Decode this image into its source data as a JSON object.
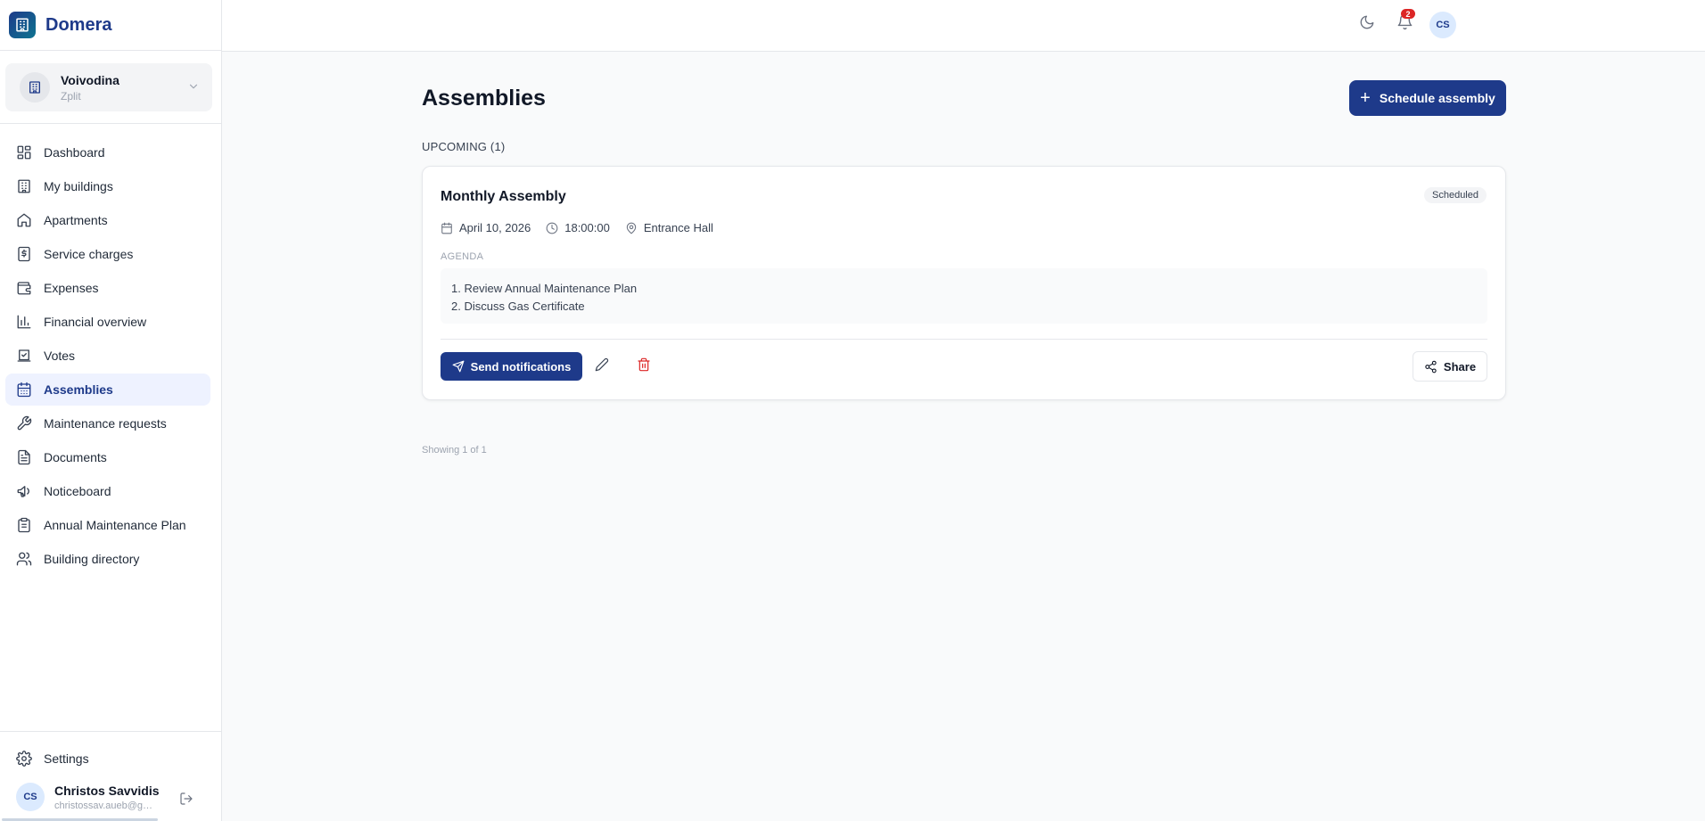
{
  "app": {
    "name": "Domera"
  },
  "building": {
    "name": "Voivodina",
    "subtitle": "Zplit"
  },
  "nav": {
    "items": [
      {
        "label": "Dashboard",
        "icon": "grid-icon"
      },
      {
        "label": "My buildings",
        "icon": "building-icon"
      },
      {
        "label": "Apartments",
        "icon": "home-icon"
      },
      {
        "label": "Service charges",
        "icon": "dollar-receipt-icon"
      },
      {
        "label": "Expenses",
        "icon": "wallet-icon"
      },
      {
        "label": "Financial overview",
        "icon": "bar-chart-icon"
      },
      {
        "label": "Votes",
        "icon": "ballot-check-icon"
      },
      {
        "label": "Assemblies",
        "icon": "calendar-icon",
        "active": true
      },
      {
        "label": "Maintenance requests",
        "icon": "wrench-icon"
      },
      {
        "label": "Documents",
        "icon": "document-icon"
      },
      {
        "label": "Noticeboard",
        "icon": "megaphone-icon"
      },
      {
        "label": "Annual Maintenance Plan",
        "icon": "clipboard-icon"
      },
      {
        "label": "Building directory",
        "icon": "users-icon"
      }
    ]
  },
  "sidebar_bottom": {
    "settings_label": "Settings",
    "user": {
      "initials": "CS",
      "name": "Christos Savvidis",
      "email": "christossav.aueb@gmail.com"
    }
  },
  "topbar": {
    "notification_count": "2",
    "avatar_initials": "CS"
  },
  "page": {
    "title": "Assemblies",
    "schedule_button": "Schedule assembly",
    "section_label": "UPCOMING (1)",
    "showing": "Showing 1 of 1"
  },
  "assembly": {
    "title": "Monthly Assembly",
    "status": "Scheduled",
    "date": "April 10, 2026",
    "time": "18:00:00",
    "location": "Entrance Hall",
    "agenda_label": "AGENDA",
    "agenda": [
      "1. Review Annual Maintenance Plan",
      "2. Discuss Gas Certificate"
    ],
    "send_button": "Send notifications",
    "share_button": "Share"
  },
  "colors": {
    "primary": "#1e3a8a",
    "danger": "#dc2626",
    "active_bg": "#eef2ff"
  }
}
